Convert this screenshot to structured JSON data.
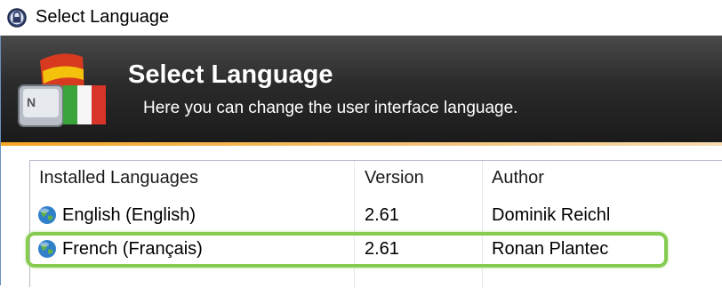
{
  "window": {
    "title": "Select Language"
  },
  "banner": {
    "title": "Select Language",
    "subtitle": "Here you can change the user interface language."
  },
  "table": {
    "columns": [
      "Installed Languages",
      "Version",
      "Author"
    ],
    "rows": [
      {
        "language": "English (English)",
        "version": "2.61",
        "author": "Dominik Reichl",
        "icon": "globe-icon"
      },
      {
        "language": "French (Français)",
        "version": "2.61",
        "author": "Ronan Plantec",
        "icon": "globe-icon",
        "highlighted": true
      }
    ]
  },
  "colors": {
    "banner_dark": "#1a1a1a",
    "banner_accent": "#f5a623",
    "highlight": "#86cb4f"
  }
}
